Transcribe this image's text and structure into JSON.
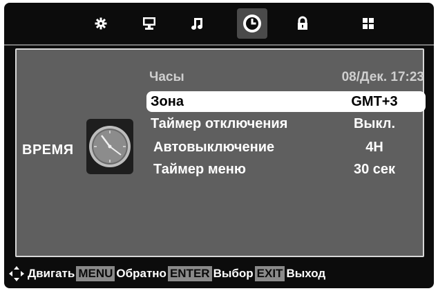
{
  "tabs": [
    {
      "icon": "gear-icon"
    },
    {
      "icon": "monitor-icon"
    },
    {
      "icon": "music-note-icon"
    },
    {
      "icon": "clock-icon",
      "active": true
    },
    {
      "icon": "lock-icon"
    },
    {
      "icon": "grid-icon"
    }
  ],
  "section": {
    "label": "ВРЕМЯ"
  },
  "header": {
    "title": "Часы",
    "datetime": "08/Дек.  17:23"
  },
  "menu": [
    {
      "label": "Зона",
      "value": "GMT+3",
      "selected": true
    },
    {
      "label": "Таймер отключения",
      "value": "Выкл."
    },
    {
      "label": "Автовыключение",
      "value": "4H"
    },
    {
      "label": "Таймер меню",
      "value": "30 сек"
    }
  ],
  "help": {
    "move": "Двигать",
    "menu_key": "MENU",
    "back": "Обратно",
    "enter_key": "ENTER",
    "select": "Выбор",
    "exit_key": "EXIT",
    "exit": "Выход"
  },
  "colors": {
    "background": "#0c0c0c",
    "panel": "#5f5f5f",
    "highlight": "#ffffff"
  }
}
